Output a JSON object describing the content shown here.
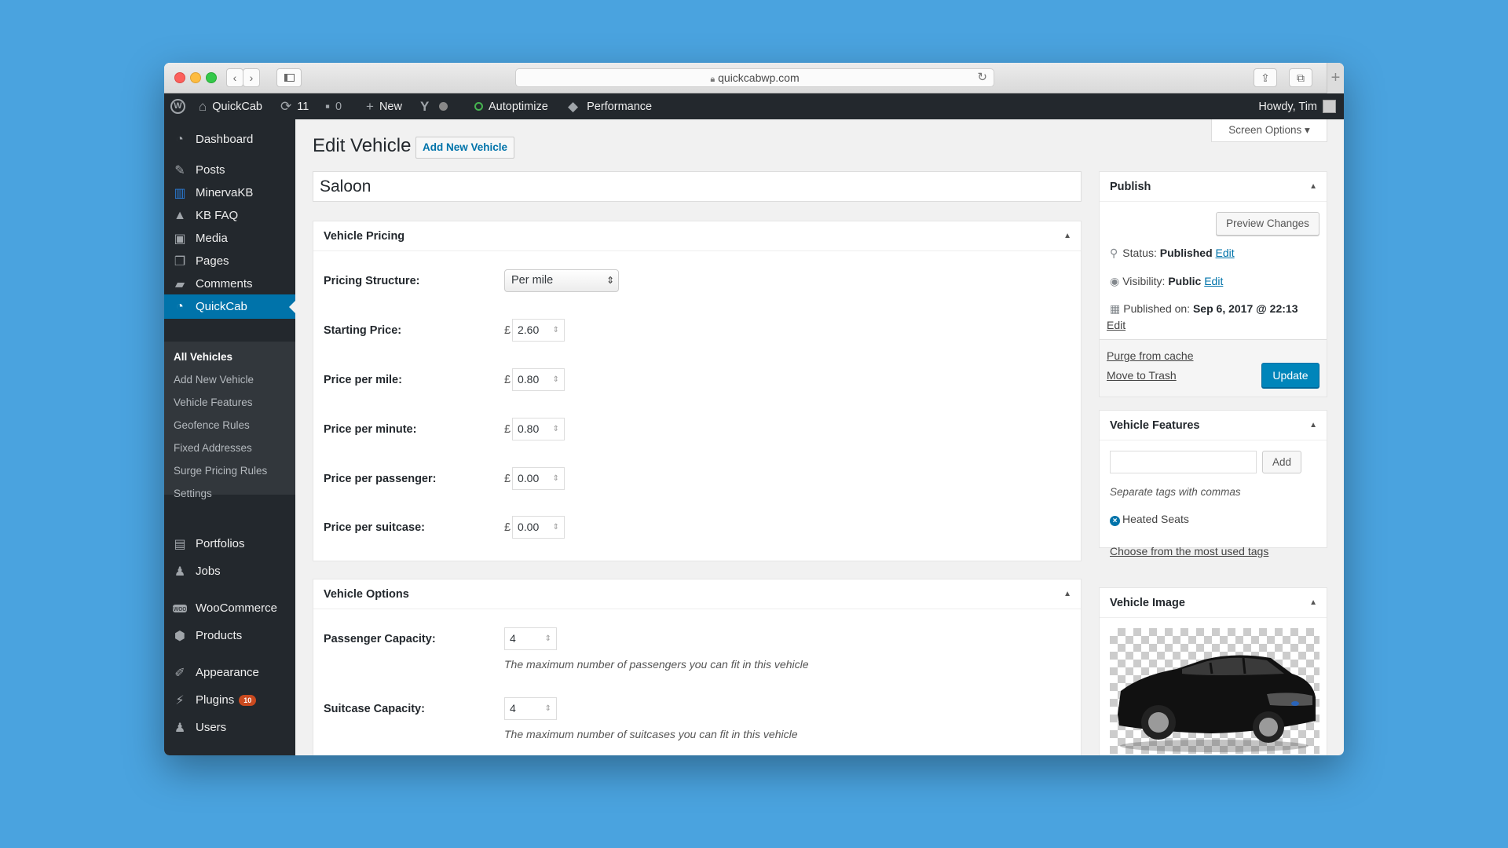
{
  "browser": {
    "url": "quickcabwp.com"
  },
  "adminbar": {
    "site_name": "QuickCab",
    "updates_count": "11",
    "comments_count": "0",
    "new_label": "New",
    "autoptimize_label": "Autoptimize",
    "performance_label": "Performance",
    "howdy": "Howdy, Tim"
  },
  "sidebar": {
    "items": [
      {
        "label": "Dashboard",
        "icon": "dashboard-icon"
      },
      {
        "label": "Posts",
        "icon": "pin-icon"
      },
      {
        "label": "MinervaKB",
        "icon": "book-icon"
      },
      {
        "label": "KB FAQ",
        "icon": "graduation-cap-icon"
      },
      {
        "label": "Media",
        "icon": "media-icon"
      },
      {
        "label": "Pages",
        "icon": "pages-icon"
      },
      {
        "label": "Comments",
        "icon": "comment-icon"
      },
      {
        "label": "QuickCab",
        "icon": "dashboard-icon"
      },
      {
        "label": "Portfolios",
        "icon": "folder-icon"
      },
      {
        "label": "Jobs",
        "icon": "user-icon"
      },
      {
        "label": "WooCommerce",
        "icon": "woocommerce-icon"
      },
      {
        "label": "Products",
        "icon": "box-icon"
      },
      {
        "label": "Appearance",
        "icon": "brush-icon"
      },
      {
        "label": "Plugins",
        "icon": "plug-icon",
        "badge": "10"
      },
      {
        "label": "Users",
        "icon": "user-icon"
      }
    ],
    "submenu": [
      "All Vehicles",
      "Add New Vehicle",
      "Vehicle Features",
      "Geofence Rules",
      "Fixed Addresses",
      "Surge Pricing Rules",
      "Settings"
    ]
  },
  "screen_options": "Screen Options",
  "page": {
    "title": "Edit Vehicle",
    "add_new": "Add New Vehicle",
    "post_title": "Saloon"
  },
  "pricing": {
    "heading": "Vehicle Pricing",
    "currency": "£",
    "structure_label": "Pricing Structure:",
    "structure_value": "Per mile",
    "rows": [
      {
        "label": "Starting Price:",
        "value": "2.60"
      },
      {
        "label": "Price per mile:",
        "value": "0.80"
      },
      {
        "label": "Price per minute:",
        "value": "0.80"
      },
      {
        "label": "Price per passenger:",
        "value": "0.00"
      },
      {
        "label": "Price per suitcase:",
        "value": "0.00"
      }
    ]
  },
  "options": {
    "heading": "Vehicle Options",
    "passenger_label": "Passenger Capacity:",
    "passenger_value": "4",
    "passenger_hint": "The maximum number of passengers you can fit in this vehicle",
    "suitcase_label": "Suitcase Capacity:",
    "suitcase_value": "4",
    "suitcase_hint": "The maximum number of suitcases you can fit in this vehicle"
  },
  "publish": {
    "heading": "Publish",
    "preview": "Preview Changes",
    "status_label": "Status:",
    "status_value": "Published",
    "visibility_label": "Visibility:",
    "visibility_value": "Public",
    "published_label": "Published on:",
    "published_value": "Sep 6, 2017 @ 22:13",
    "edit": "Edit",
    "purge": "Purge from cache",
    "trash": "Move to Trash",
    "update": "Update"
  },
  "features": {
    "heading": "Vehicle Features",
    "add": "Add",
    "hint": "Separate tags with commas",
    "tags": [
      "Heated Seats"
    ],
    "choose": "Choose from the most used tags"
  },
  "image": {
    "heading": "Vehicle Image"
  }
}
